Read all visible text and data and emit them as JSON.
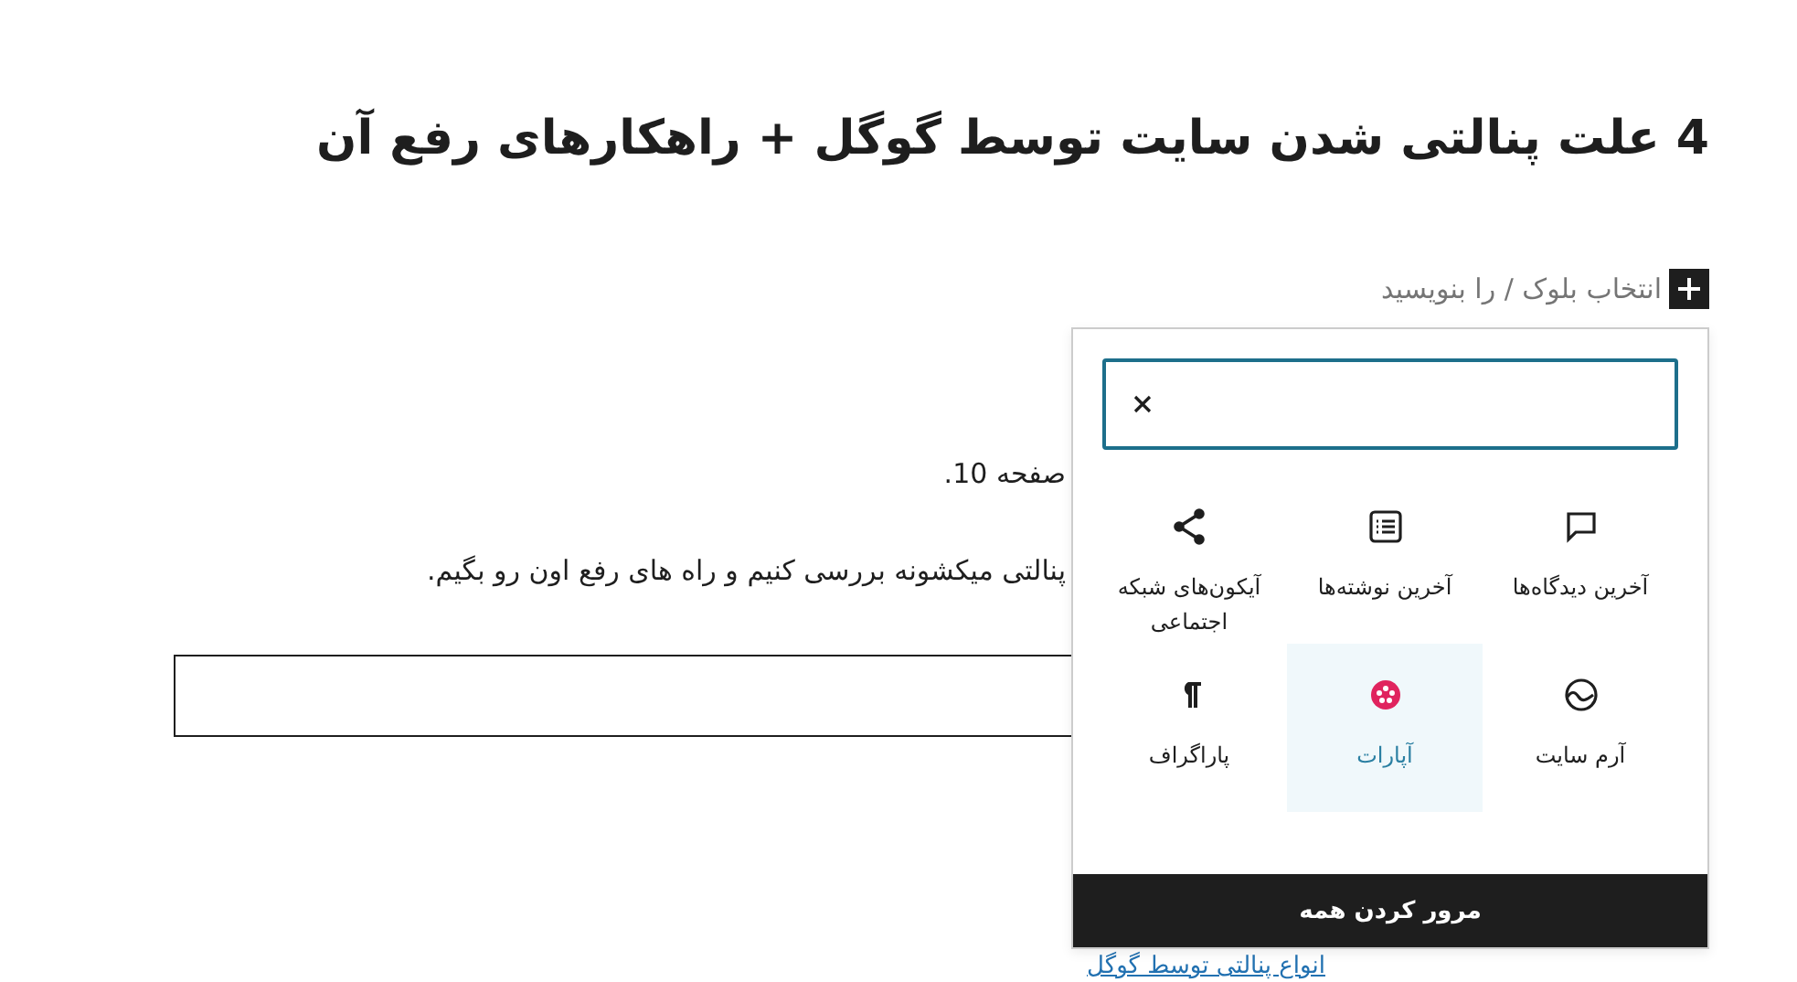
{
  "title": "4 علت پنالتی شدن سایت توسط گوگل + راهکارهای رفع آن",
  "block_placeholder": "انتخاب بلوک / را بنویسید",
  "paragraphs": [
    "صفحه 10.",
    "پنالتی میکشونه بررسی کنیم و راه های رفع اون رو بگیم."
  ],
  "link": "انواع پنالتی توسط گوگل",
  "inserter": {
    "blocks": [
      {
        "label": "آخرین دیدگاه‌ها",
        "kind": "comments",
        "selected": false
      },
      {
        "label": "آخرین نوشته‌ها",
        "kind": "list",
        "selected": false
      },
      {
        "label": "آیکون‌های شبکه اجتماعی",
        "kind": "share",
        "selected": false
      },
      {
        "label": "آرم سایت",
        "kind": "logo",
        "selected": false
      },
      {
        "label": "آپارات",
        "kind": "aparat",
        "selected": true
      },
      {
        "label": "پاراگراف",
        "kind": "paragraph",
        "selected": false
      }
    ],
    "browse_all": "مرور کردن همه"
  }
}
